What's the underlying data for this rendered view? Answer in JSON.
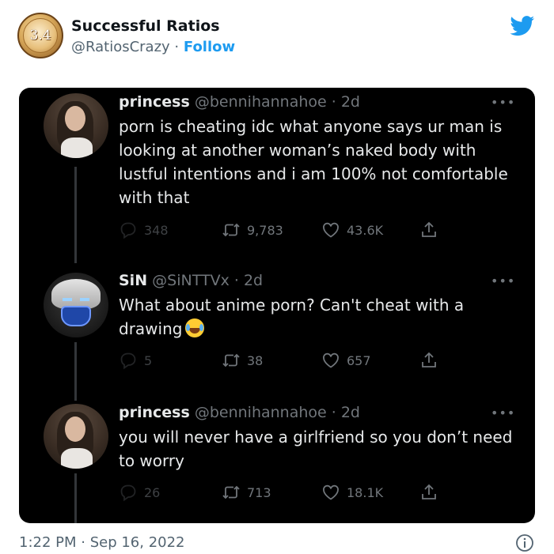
{
  "embed": {
    "account_name": "Successful Ratios",
    "handle": "@RatiosCrazy",
    "separator": " · ",
    "follow_label": "Follow",
    "avatar_text": "3.4",
    "brand_color": "#1d9bf0",
    "timestamp": "1:22 PM · Sep 16, 2022",
    "icons": {
      "brand": "twitter-bird-icon",
      "info": "info-icon"
    }
  },
  "tweets": [
    {
      "name": "princess",
      "handle": "@bennihannahoe",
      "age": "· 2d",
      "text": "porn is cheating idc what anyone says ur man is looking at another woman’s naked body with lustful intentions and i am 100% not comfortable with that",
      "replies": "348",
      "retweets": "9,783",
      "likes": "43.6K"
    },
    {
      "name": "SiN",
      "handle": "@SiNTTVx",
      "age": "· 2d",
      "text": "What about anime porn? Can't cheat with a drawing",
      "emoji": "face-with-tears-of-joy",
      "replies": "5",
      "retweets": "38",
      "likes": "657"
    },
    {
      "name": "princess",
      "handle": "@bennihannahoe",
      "age": "· 2d",
      "text": "you will never have a girlfriend so you don’t need to worry",
      "replies": "26",
      "retweets": "713",
      "likes": "18.1K"
    }
  ],
  "more_label": "•••"
}
